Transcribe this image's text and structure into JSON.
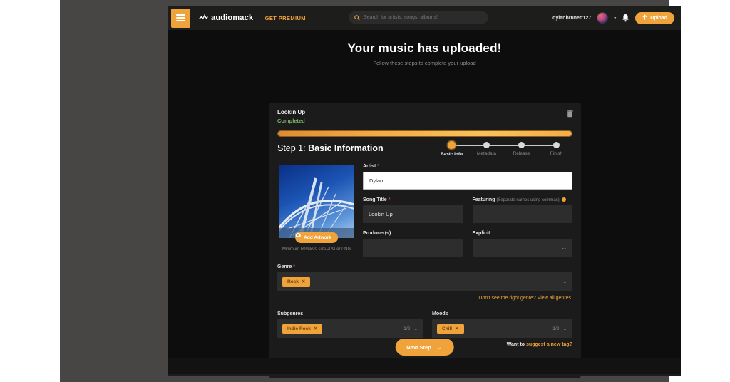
{
  "accent_color": "#f0a23b",
  "status_color": "#7cb56b",
  "required_marker": "*",
  "symbols": {
    "close": "✕",
    "caret": "▾",
    "chevron": "⌄",
    "arrow_right": "→",
    "pipe": "|"
  },
  "topbar": {
    "logo_text": "audiomack",
    "premium_label": "GET PREMIUM",
    "search_placeholder": "Search for artists, songs, albums!",
    "username": "dylanbrunett127",
    "upload_label": "Upload"
  },
  "page": {
    "title": "Your music has uploaded!",
    "subtitle": "Follow these steps to complete your upload"
  },
  "upload_item": {
    "name": "Lookin Up",
    "status": "Completed",
    "progress_percent": 100
  },
  "step_header": {
    "prefix": "Step 1: ",
    "title": "Basic Information"
  },
  "stepper": {
    "steps": [
      {
        "label": "Basic Info",
        "state": "active"
      },
      {
        "label": "Metadata",
        "state": "inactive"
      },
      {
        "label": "Release",
        "state": "inactive"
      },
      {
        "label": "Finish",
        "state": "inactive"
      }
    ]
  },
  "artwork": {
    "button_label": "Add Artwork",
    "hint": "Minimum 500x500 size,JPG or PNG"
  },
  "form": {
    "artist": {
      "label": "Artist",
      "value": "Dylan"
    },
    "song_title": {
      "label": "Song Title",
      "value": "Lookin Up"
    },
    "featuring": {
      "label": "Featuring",
      "hint": "(Separate names using commas)",
      "value": ""
    },
    "producers": {
      "label": "Producer(s)",
      "value": ""
    },
    "explicit": {
      "label": "Explicit",
      "value": ""
    },
    "genre": {
      "label": "Genre",
      "tags": [
        "Rock"
      ]
    },
    "genre_help_plain": "Don't see the right genre? ",
    "genre_help_link": "View all genres.",
    "subgenres": {
      "label": "Subgenres",
      "tags": [
        "Indie Rock"
      ],
      "counter": "1/2"
    },
    "moods": {
      "label": "Moods",
      "tags": [
        "Chill"
      ],
      "counter": "1/2"
    },
    "tag_help_plain": "Want to ",
    "tag_help_link": "suggest a new tag?"
  },
  "next_button_label": "Next Step"
}
